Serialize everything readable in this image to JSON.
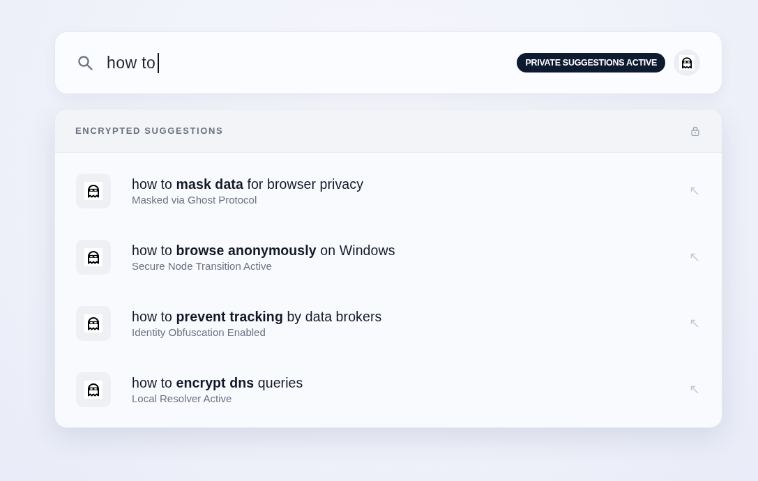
{
  "search": {
    "value": "how to",
    "focused": true,
    "badge": "PRIVATE SUGGESTIONS ACTIVE"
  },
  "suggestions_panel": {
    "heading": "ENCRYPTED SUGGESTIONS",
    "items": [
      {
        "title": "how to **mask data** for browser privacy",
        "subtitle": "Masked via Ghost Protocol"
      },
      {
        "title": "how to **browse anonymously** on Windows",
        "subtitle": "Secure Node Transition Active"
      },
      {
        "title": "how to **prevent tracking** by data brokers",
        "subtitle": "Identity Obfuscation Enabled"
      },
      {
        "title": "how to **encrypt dns** queries",
        "subtitle": "Local Resolver Active"
      }
    ]
  }
}
